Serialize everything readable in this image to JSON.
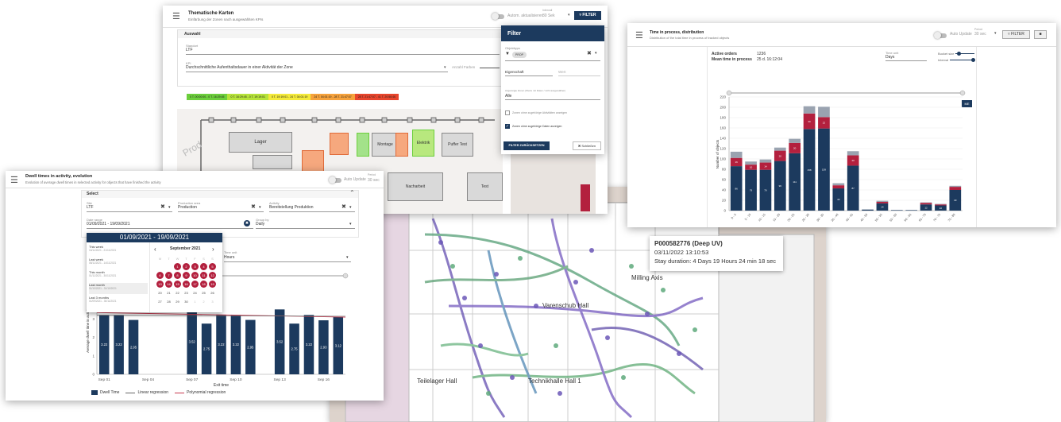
{
  "map_view": {
    "labels": [
      "Milling Axis",
      "Varenschub Hall",
      "Teilelager Hall",
      "Technikhalle Hall 1"
    ],
    "tooltip": {
      "title": "P000582776 (Deep UV)",
      "timestamp": "03/11/2022 13:10:53",
      "duration": "Stay duration: 4 Days 19 Hours 24 min 18 sec"
    }
  },
  "thematic": {
    "title": "Thematische Karten",
    "subtitle": "Einfärbung der Zonen nach ausgewählten KPIs",
    "auto_update": "Autom. aktualisieren",
    "interval_label": "Intervall",
    "interval_value": "30 Sek",
    "filter_button": "FILTER",
    "section_title": "Auswahl",
    "site_label": "Standort",
    "site_value": "LTF",
    "kpi_label": "KPI",
    "kpi_value": "Durchschnittliche Aufenthaltsdauer in einer Aktivität der Zone",
    "colors_label": "Anzahl Farben",
    "legend": [
      {
        "text": "0 T. 00:00:00 - 0 T. 16:29:45",
        "color": "#6ccf3c"
      },
      {
        "text": "0 T. 16:29:45 - 0 T. 19:19:01",
        "color": "#b6e33a"
      },
      {
        "text": "0 T. 19:19:01 - 24 T. 04:01:19",
        "color": "#f4ea3a"
      },
      {
        "text": "24 T. 04:01:19 - 28 T. 21:47:07",
        "color": "#f6a23c"
      },
      {
        "text": "28 T. 21:47:07 - 41 T. 20:56:46",
        "color": "#e8452c"
      }
    ],
    "zones": [
      "Lager",
      "Montage",
      "Elektrik",
      "Puffer Test",
      "Nacharbeit",
      "Test"
    ]
  },
  "filter_panel": {
    "title": "Filter",
    "attribute_label": "Objekttyps",
    "chip": "PROP",
    "property": "Eigenschaft",
    "value": "Wert",
    "zones_label": "Angezeigte Zonen (Werte mit Daten / nicht ausgewählen)",
    "zones_value": "Alle",
    "check1": "Zonen ohne zugehörige Aktivitäten anzeigen",
    "check2": "Zonen ohne zugehörige Daten anzeigen",
    "reset": "FILTER ZURÜCKSETZEN",
    "close": "Schließen"
  },
  "distribution": {
    "title": "Time in process, distribution",
    "subtitle": "Distribution of the total time in process of tracked objects",
    "auto_update": "Auto Update",
    "interval_label": "Period",
    "interval_value": "30 sec",
    "filter_button": "FILTER",
    "active_orders_label": "Active orders",
    "active_orders_value": "1236",
    "mean_time_label": "Mean time in process",
    "mean_time_value": "25 d. 16:12:04",
    "time_unit_label": "Time unit",
    "time_unit_value": "Days",
    "bucket_label": "Bucket size",
    "interval_slider_label": "Interval",
    "chart_tag": "ME"
  },
  "dwell": {
    "title": "Dwell times in activity, evolution",
    "subtitle": "Evolution of average dwell times in selected activity for objects that have finished the activity",
    "auto_update": "Auto Update",
    "interval_label": "Period",
    "interval_value": "30 sec",
    "select_title": "Select",
    "site_label": "Site",
    "site_value": "LTF",
    "area_label": "Production area",
    "area_value": "Production",
    "activity_label": "Activity",
    "activity_value": "Bereitstellung Produktion",
    "date_label": "Date range",
    "date_value": "01/09/2021 - 19/09/2021",
    "group_label": "Group by",
    "group_value": "Daily",
    "unit_label": "Time unit",
    "unit_value": "Hours",
    "range_header": "01/09/2021 - 19/09/2021",
    "presets": [
      {
        "name": "This week",
        "range": "15/11/2021 - 21/11/2021"
      },
      {
        "name": "Last week",
        "range": "08/11/2021 - 14/11/2021"
      },
      {
        "name": "This month",
        "range": "01/11/2021 - 30/11/2021"
      },
      {
        "name": "Last month",
        "range": "01/10/2021 - 31/10/2021"
      },
      {
        "name": "Last 3 months",
        "range": "01/09/2021 - 30/11/2021"
      }
    ],
    "month_label": "September 2021",
    "weekdays": [
      "M",
      "T",
      "W",
      "T",
      "F",
      "S",
      "S"
    ],
    "legend": [
      "Dwell Time",
      "Linear regression",
      "Polynomial regression"
    ]
  },
  "chart_data": [
    {
      "type": "bar",
      "title": "Time in process, distribution",
      "xlabel": "",
      "ylabel": "Number of objects",
      "ylim": [
        0,
        220
      ],
      "categories": [
        "0 - 5",
        "5 - 10",
        "10 - 15",
        "15 - 20",
        "20 - 25",
        "25 - 30",
        "30 - 35",
        "35 - 40",
        "40 - 45",
        "45 - 50",
        "50 - 55",
        "55 - 60",
        "60 - 65",
        "65 - 70",
        "70 - 75",
        "75 - 80"
      ],
      "series": [
        {
          "name": "",
          "color": "#1c3a5e",
          "values": [
            86,
            79,
            79,
            96,
            111,
            158,
            159,
            43,
            87,
            2,
            14,
            1,
            1,
            12,
            10,
            40
          ]
        },
        {
          "name": "",
          "color": "#b3203e",
          "values": [
            16,
            10,
            14,
            20,
            20,
            30,
            22,
            6,
            20,
            0,
            3,
            0,
            0,
            3,
            2,
            6
          ]
        },
        {
          "name": "",
          "color": "#9aa3b0",
          "values": [
            12,
            6,
            6,
            6,
            8,
            14,
            20,
            4,
            8,
            0,
            2,
            0,
            0,
            1,
            1,
            2
          ]
        }
      ]
    },
    {
      "type": "bar",
      "title": "Dwell times in activity, evolution",
      "xlabel": "Exit time",
      "ylabel": "Average dwell time in activity",
      "ylim": [
        0,
        5
      ],
      "x_ticks": [
        "Sep 01",
        "Sep 04",
        "Sep 07",
        "Sep 10",
        "Sep 13",
        "Sep 16"
      ],
      "categories": [
        "Sep 01",
        "Sep 02",
        "Sep 03",
        "Sep 04",
        "Sep 05",
        "Sep 06",
        "Sep 07",
        "Sep 08",
        "Sep 09",
        "Sep 10",
        "Sep 11",
        "Sep 12",
        "Sep 13",
        "Sep 14",
        "Sep 15",
        "Sep 16",
        "Sep 17"
      ],
      "values": [
        3.22,
        3.22,
        2.95,
        null,
        null,
        null,
        3.52,
        2.75,
        3.22,
        3.22,
        2.95,
        null,
        3.52,
        2.75,
        3.22,
        2.93,
        3.12
      ],
      "series_names": [
        "Dwell Time",
        "Linear regression",
        "Polynomial regression"
      ]
    }
  ]
}
